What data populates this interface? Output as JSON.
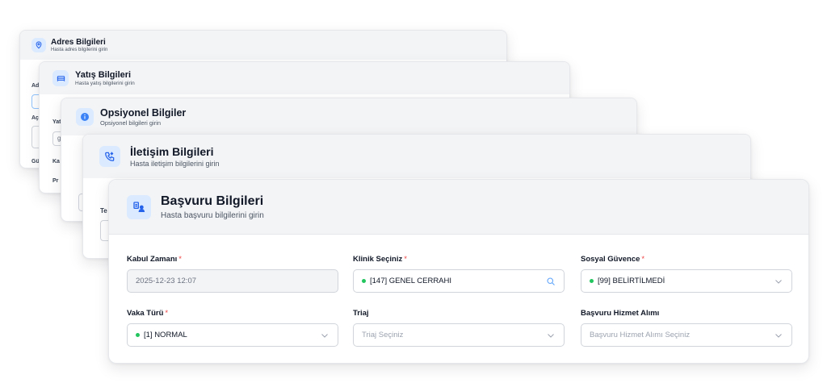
{
  "sections": {
    "adres": {
      "title": "Adres Bilgileri",
      "subtitle": "Hasta adres bilgilerini girin",
      "peek_labels": [
        "Ad",
        "Aç",
        "Gü"
      ]
    },
    "yatis": {
      "title": "Yatış Bilgileri",
      "subtitle": "Hasta yatış bilgilerini girin",
      "peek_labels": [
        "Yat",
        "Ka",
        "Pr"
      ],
      "peek_value": "g"
    },
    "opsiyonel": {
      "title": "Opsiyonel Bilgiler",
      "subtitle": "Opsiyonel bilgileri girin"
    },
    "iletisim": {
      "title": "İletişim Bilgileri",
      "subtitle": "Hasta iletişim bilgilerini girin",
      "peek_label": "Te"
    },
    "basvuru": {
      "title": "Başvuru Bilgileri",
      "subtitle": "Hasta başvuru bilgilerini girin",
      "fields": {
        "kabul_zamani": {
          "label": "Kabul Zamanı",
          "required": "*",
          "value": "2025-12-23 12:07"
        },
        "klinik": {
          "label": "Klinik Seçiniz",
          "required": "*",
          "value": "[147] GENEL CERRAHI",
          "icon": "search-icon"
        },
        "sosyal_guvence": {
          "label": "Sosyal Güvence",
          "required": "*",
          "value": "[99] BELİRTİLMEDİ",
          "icon": "chevron-down-icon"
        },
        "vaka_turu": {
          "label": "Vaka Türü",
          "required": "*",
          "value": "[1] NORMAL",
          "icon": "chevron-down-icon"
        },
        "triaj": {
          "label": "Triaj",
          "placeholder": "Triaj Seçiniz",
          "icon": "chevron-down-icon"
        },
        "hizmet_alimi": {
          "label": "Başvuru Hizmet Alımı",
          "placeholder": "Başvuru Hizmet Alımı Seçiniz",
          "icon": "chevron-down-icon"
        }
      }
    }
  },
  "colors": {
    "accent": "#2563eb",
    "icon_bg": "#dbeafe",
    "header_bg": "#f3f4f6",
    "required": "#ef4444",
    "status_dot": "#22c55e"
  }
}
